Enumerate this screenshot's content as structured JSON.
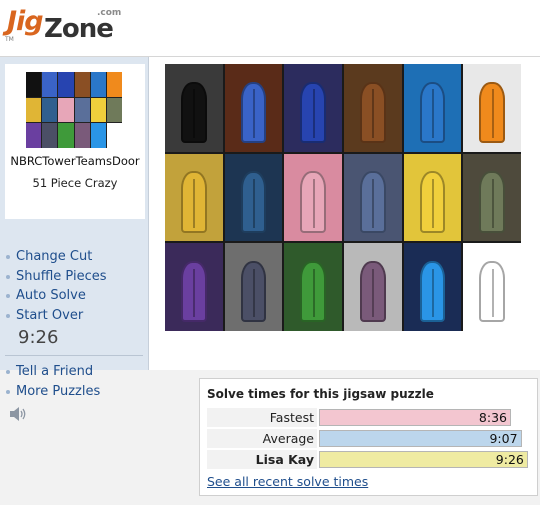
{
  "header": {
    "logo_jig": "Jig",
    "logo_zone": "Zone",
    "logo_com": ".com",
    "logo_tm": "TM"
  },
  "sidebar": {
    "puzzle_name": "NBRCTowerTeamsDoor",
    "piece_count": "51 Piece Crazy",
    "menu_items": [
      {
        "label": "Change Cut"
      },
      {
        "label": "Shuffle Pieces"
      },
      {
        "label": "Auto Solve"
      },
      {
        "label": "Start Over"
      }
    ],
    "timer": "9:26",
    "menu_items_2": [
      {
        "label": "Tell a Friend"
      },
      {
        "label": "More Puzzles"
      }
    ],
    "sound_icon": "speaker-icon"
  },
  "puzzle": {
    "tile_colors": [
      {
        "bg": "#3a3a3a",
        "door": "#111111"
      },
      {
        "bg": "#5a2b18",
        "door": "#3a63c7"
      },
      {
        "bg": "#2c2c5e",
        "door": "#2744b0"
      },
      {
        "bg": "#5b3a1e",
        "door": "#8a4f24"
      },
      {
        "bg": "#1e6fb5",
        "door": "#2a77c9"
      },
      {
        "bg": "#e8e8e8",
        "door": "#f08a1c"
      },
      {
        "bg": "#c2a23b",
        "door": "#e0b535"
      },
      {
        "bg": "#1d3552",
        "door": "#2f5f8f"
      },
      {
        "bg": "#d98ba0",
        "door": "#e7a6b8"
      },
      {
        "bg": "#4a5572",
        "door": "#5a6f9a"
      },
      {
        "bg": "#e2c53a",
        "door": "#f0cf3c"
      },
      {
        "bg": "#4e4a3c",
        "door": "#6f7a5a"
      },
      {
        "bg": "#3b2a5a",
        "door": "#6a3fa0"
      },
      {
        "bg": "#6e6e6e",
        "door": "#4b4f66"
      },
      {
        "bg": "#2f5a2b",
        "door": "#3f9a3a"
      },
      {
        "bg": "#b9b9b9",
        "door": "#7a5a7a"
      },
      {
        "bg": "#1a2c55",
        "door": "#2a95e6"
      },
      {
        "bg": "#ffffff",
        "door": "#ffffff"
      }
    ]
  },
  "solve_times": {
    "title": "Solve times for this jigsaw puzzle",
    "rows": [
      {
        "label": "Fastest",
        "value": "8:36",
        "color": "#f3c6d0",
        "fraction": 0.91,
        "bold": false
      },
      {
        "label": "Average",
        "value": "9:07",
        "color": "#bcd6ec",
        "fraction": 0.96,
        "bold": false
      },
      {
        "label": "Lisa Kay",
        "value": "9:26",
        "color": "#efeba2",
        "fraction": 0.99,
        "bold": true
      }
    ],
    "see_all": "See all recent solve times"
  }
}
